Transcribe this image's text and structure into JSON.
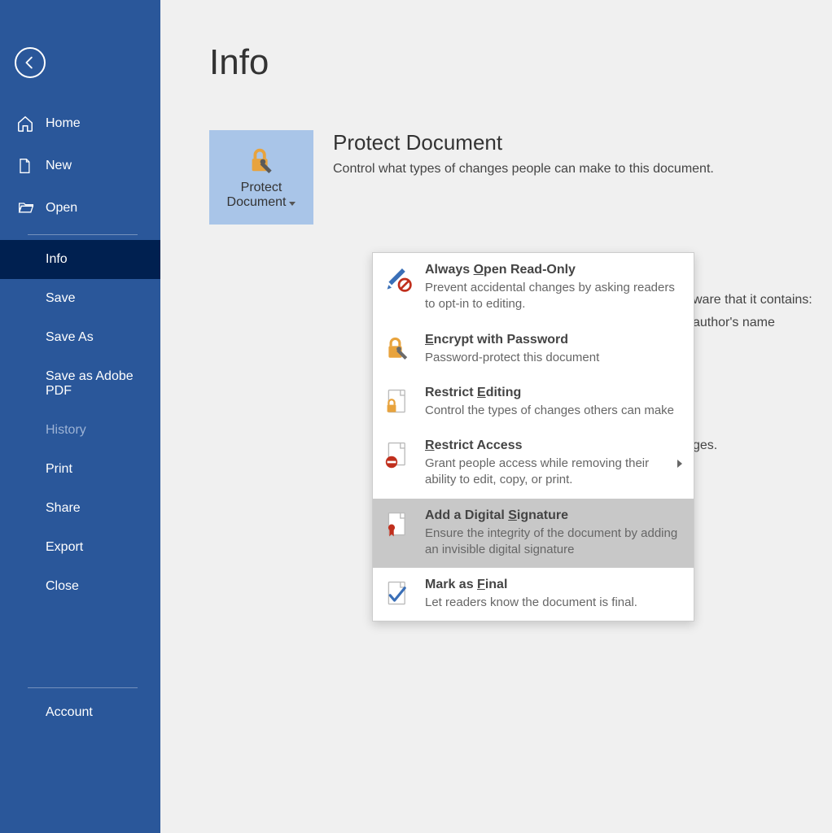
{
  "sidebar": {
    "top": [
      {
        "label": "Home",
        "icon": "home"
      },
      {
        "label": "New",
        "icon": "new"
      },
      {
        "label": "Open",
        "icon": "open"
      }
    ],
    "mid": [
      {
        "label": "Info",
        "selected": true
      },
      {
        "label": "Save"
      },
      {
        "label": "Save As"
      },
      {
        "label": "Save as Adobe PDF"
      },
      {
        "label": "History",
        "dim": true
      },
      {
        "label": "Print"
      },
      {
        "label": "Share"
      },
      {
        "label": "Export"
      },
      {
        "label": "Close"
      }
    ],
    "bottom": [
      {
        "label": "Account"
      }
    ]
  },
  "page": {
    "title": "Info",
    "protect": {
      "button_line1": "Protect",
      "button_line2": "Document",
      "heading": "Protect Document",
      "desc": "Control what types of changes people can make to this document."
    },
    "bg_lines": {
      "a": "ware that it contains:",
      "b": "author's name",
      "c": "ges."
    }
  },
  "dropdown": {
    "items": [
      {
        "title_pre": "Always ",
        "u": "O",
        "title_post": "pen Read-Only",
        "desc": "Prevent accidental changes by asking readers to opt-in to editing.",
        "icon": "pencil"
      },
      {
        "title_pre": "",
        "u": "E",
        "title_post": "ncrypt with Password",
        "desc": "Password-protect this document",
        "icon": "lock"
      },
      {
        "title_pre": "Restrict ",
        "u": "E",
        "title_post": "diting",
        "desc": "Control the types of changes others can make",
        "icon": "doclock"
      },
      {
        "title_pre": "",
        "u": "R",
        "title_post": "estrict Access",
        "desc": "Grant people access while removing their ability to edit, copy, or print.",
        "icon": "docno",
        "submenu": true
      },
      {
        "title_pre": "Add a Digital ",
        "u": "S",
        "title_post": "ignature",
        "desc": "Ensure the integrity of the document by adding an invisible digital signature",
        "icon": "docsig",
        "hl": true
      },
      {
        "title_pre": "Mark as ",
        "u": "F",
        "title_post": "inal",
        "desc": "Let readers know the document is final.",
        "icon": "doccheck"
      }
    ]
  }
}
